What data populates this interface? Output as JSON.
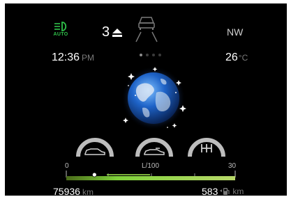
{
  "status_bar": {
    "light_mode": "AUTO",
    "gear": "3",
    "compass_heading": "NW"
  },
  "info_row": {
    "time": "12:36",
    "time_period": "PM",
    "temperature": "26",
    "temperature_unit": "°C",
    "page_count": 4,
    "active_page": 1
  },
  "center_graphic": {
    "icon": "earth-globe-icon"
  },
  "gauges": [
    {
      "icon": "vehicle-side-icon"
    },
    {
      "icon": "vehicle-side-icon"
    },
    {
      "icon": "gear-shift-icon"
    }
  ],
  "consumption": {
    "scale_min": "0",
    "scale_max": "30",
    "unit": "L/100",
    "current": 5
  },
  "trip": {
    "odometer": "75936",
    "odometer_unit": "km",
    "range": "583",
    "range_unit": "km"
  },
  "colors": {
    "screen": "#000000",
    "accent_green": "#2fc24a",
    "bar_green": "#7fd23a",
    "dim_text": "#7a7a7a"
  }
}
